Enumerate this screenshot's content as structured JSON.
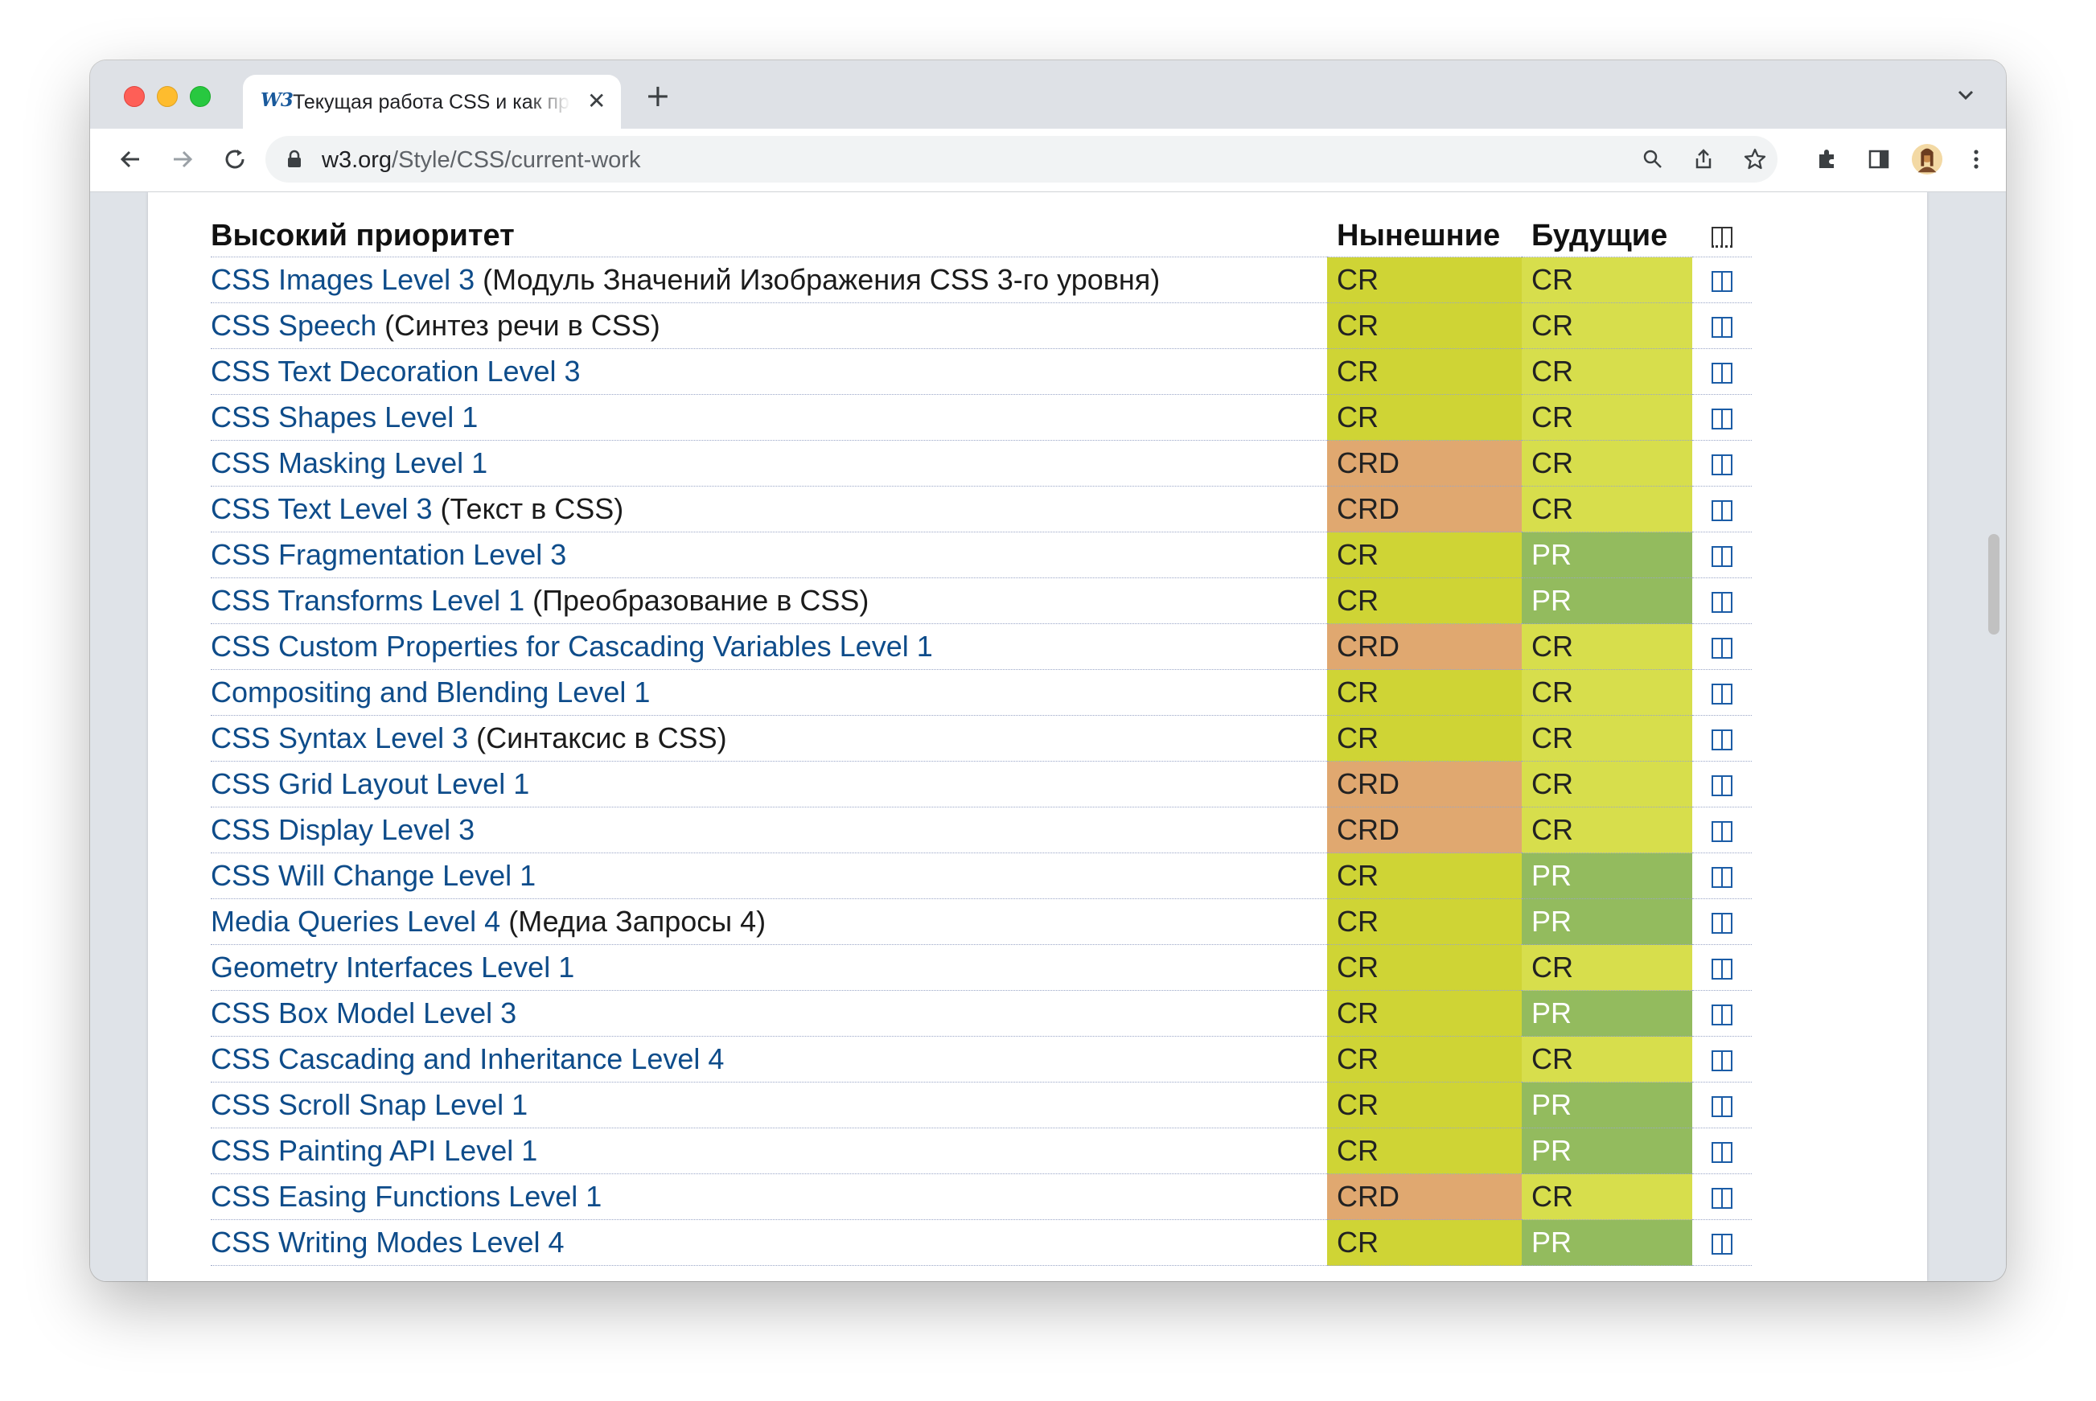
{
  "browser": {
    "tab": {
      "favicon": "W3",
      "title": "Текущая работа CSS и как пр",
      "close": "✕"
    },
    "new_tab": "+",
    "url": {
      "host": "w3.org",
      "path": "/Style/CSS/current-work"
    }
  },
  "table": {
    "headers": {
      "section": "Высокий приоритет",
      "current": "Нынешние",
      "future": "Будущие"
    },
    "rows": [
      {
        "link": "CSS Images Level 3",
        "note": " (Модуль Значений Изображения CSS 3-го уровня)",
        "current": "CR",
        "future": "CR"
      },
      {
        "link": "CSS Speech",
        "note": " (Синтез речи в CSS)",
        "current": "CR",
        "future": "CR"
      },
      {
        "link": "CSS Text Decoration Level 3",
        "note": "",
        "current": "CR",
        "future": "CR"
      },
      {
        "link": "CSS Shapes Level 1",
        "note": "",
        "current": "CR",
        "future": "CR"
      },
      {
        "link": "CSS Masking Level 1",
        "note": "",
        "current": "CRD",
        "future": "CR"
      },
      {
        "link": "CSS Text Level 3",
        "note": " (Текст в CSS)",
        "current": "CRD",
        "future": "CR"
      },
      {
        "link": "CSS Fragmentation Level 3",
        "note": "",
        "current": "CR",
        "future": "PR"
      },
      {
        "link": "CSS Transforms Level 1",
        "note": " (Преобразование в CSS)",
        "current": "CR",
        "future": "PR"
      },
      {
        "link": "CSS Custom Properties for Cascading Variables Level 1",
        "note": "",
        "current": "CRD",
        "future": "CR"
      },
      {
        "link": "Compositing and Blending Level 1",
        "note": "",
        "current": "CR",
        "future": "CR"
      },
      {
        "link": "CSS Syntax Level 3",
        "note": " (Синтаксис в CSS)",
        "current": "CR",
        "future": "CR"
      },
      {
        "link": "CSS Grid Layout Level 1",
        "note": "",
        "current": "CRD",
        "future": "CR"
      },
      {
        "link": "CSS Display Level 3",
        "note": "",
        "current": "CRD",
        "future": "CR"
      },
      {
        "link": "CSS Will Change Level 1",
        "note": "",
        "current": "CR",
        "future": "PR"
      },
      {
        "link": "Media Queries Level 4",
        "note": " (Медиа Запросы 4)",
        "current": "CR",
        "future": "PR"
      },
      {
        "link": "Geometry Interfaces Level 1",
        "note": "",
        "current": "CR",
        "future": "CR"
      },
      {
        "link": "CSS Box Model Level 3",
        "note": "",
        "current": "CR",
        "future": "PR"
      },
      {
        "link": "CSS Cascading and Inheritance Level 4",
        "note": "",
        "current": "CR",
        "future": "CR"
      },
      {
        "link": "CSS Scroll Snap Level 1",
        "note": "",
        "current": "CR",
        "future": "PR"
      },
      {
        "link": "CSS Painting API Level 1",
        "note": "",
        "current": "CR",
        "future": "PR"
      },
      {
        "link": "CSS Easing Functions Level 1",
        "note": "",
        "current": "CRD",
        "future": "CR"
      },
      {
        "link": "CSS Writing Modes Level 4",
        "note": "",
        "current": "CR",
        "future": "PR"
      }
    ]
  },
  "colors": {
    "CR_current": "#cfd435",
    "CR_future": "#d7de4c",
    "CRD": "#e0a870",
    "PR": "#93bb5e",
    "link": "#0e4c8a"
  },
  "icons": [
    "back-arrow-icon",
    "forward-arrow-icon",
    "reload-icon",
    "lock-icon",
    "search-icon",
    "share-icon",
    "star-icon",
    "extensions-icon",
    "side-panel-icon",
    "avatar",
    "kebab-menu-icon",
    "history-icon"
  ]
}
